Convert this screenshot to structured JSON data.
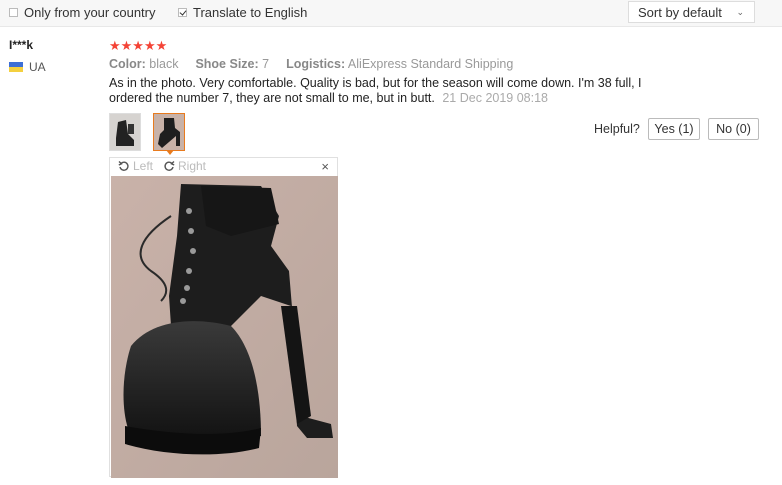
{
  "filters": {
    "only_country_label": "Only from your country",
    "only_country_checked": false,
    "translate_label": "Translate to English",
    "translate_checked": true,
    "sort_value": "Sort by default"
  },
  "review": {
    "username": "I***k",
    "country": "UA",
    "rating": 5,
    "stars": "★★★★★",
    "color_label": "Color:",
    "color_value": "black",
    "size_label": "Shoe Size:",
    "size_value": "7",
    "logistics_label": "Logistics:",
    "logistics_value": "AliExpress Standard Shipping",
    "text": "As in the photo. Very comfortable. Quality is bad, but for the season will come down. I'm 38 full, I ordered the number 7, they are not small to me, but in butt.",
    "date": "21 Dec 2019 08:18",
    "helpful_label": "Helpful?",
    "yes_label": "Yes (1)",
    "no_label": "No (0)"
  },
  "viewer": {
    "rotate_left": "Left",
    "rotate_right": "Right",
    "close": "×"
  },
  "icons": {
    "close": "close-icon",
    "rotate_left": "rotate-left-icon",
    "rotate_right": "rotate-right-icon",
    "flag": "ukraine-flag-icon",
    "dropdown": "chevron-down-icon"
  },
  "colors": {
    "star": "#f44336",
    "active_thumb": "#e87b1e"
  }
}
